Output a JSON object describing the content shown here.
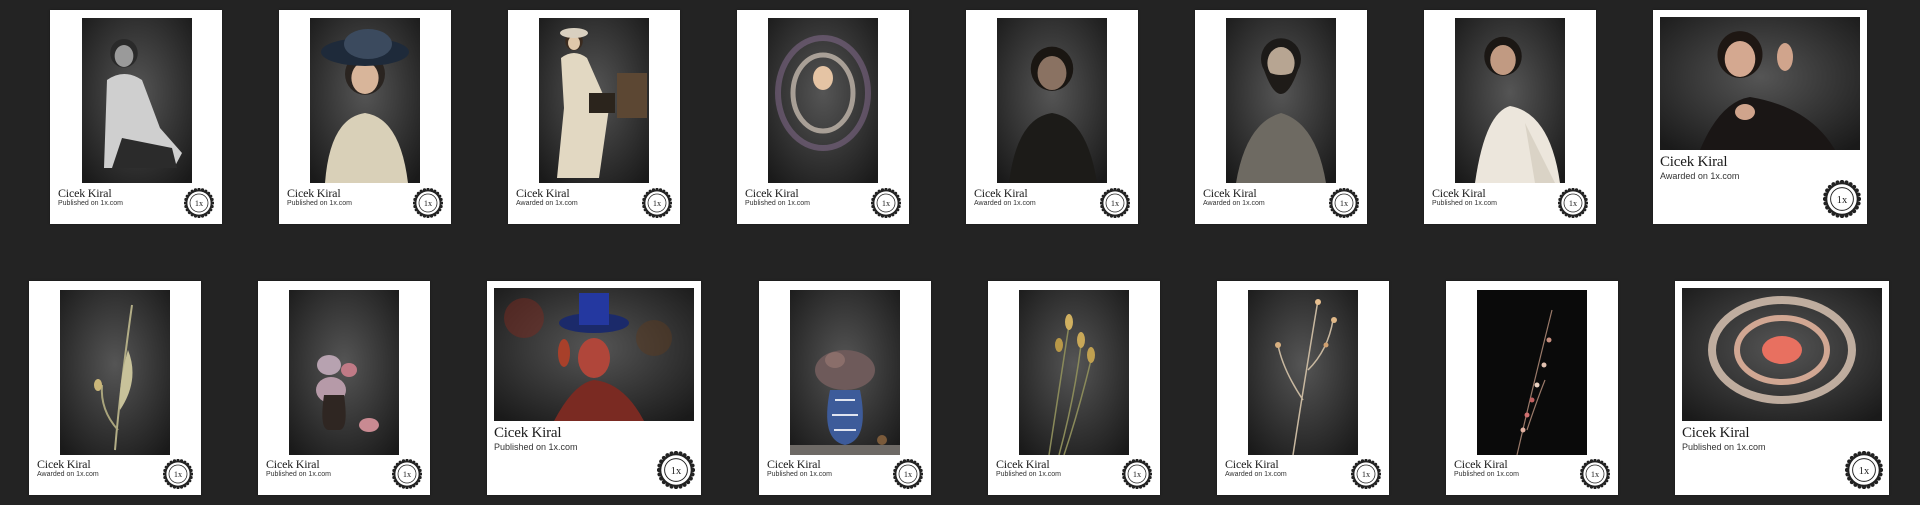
{
  "gallery": {
    "cards": [
      {
        "author": "Cicek Kiral",
        "caption": "Published on 1x.com",
        "badge": "1x-award-badge-icon",
        "subject": "man-portrait"
      },
      {
        "author": "Cicek Kiral",
        "caption": "Published on 1x.com",
        "badge": "1x-award-badge-icon",
        "subject": "woman-with-hat"
      },
      {
        "author": "Cicek Kiral",
        "caption": "Awarded on 1x.com",
        "badge": "1x-award-badge-icon",
        "subject": "seated-woman-vintage"
      },
      {
        "author": "Cicek Kiral",
        "caption": "Published on 1x.com",
        "badge": "1x-award-badge-icon",
        "subject": "spinning-blur-portrait"
      },
      {
        "author": "Cicek Kiral",
        "caption": "Awarded on 1x.com",
        "badge": "1x-award-badge-icon",
        "subject": "dark-woman-portrait"
      },
      {
        "author": "Cicek Kiral",
        "caption": "Awarded on 1x.com",
        "badge": "1x-award-badge-icon",
        "subject": "bearded-man-portrait"
      },
      {
        "author": "Cicek Kiral",
        "caption": "Published on 1x.com",
        "badge": "1x-award-badge-icon",
        "subject": "woman-lace-dress"
      },
      {
        "author": "Cicek Kiral",
        "caption": "Awarded on 1x.com",
        "badge": "1x-award-badge-icon",
        "subject": "woman-curly-hair-pose"
      },
      {
        "author": "Cicek Kiral",
        "caption": "Awarded on 1x.com",
        "badge": "1x-award-badge-icon",
        "subject": "tulip-stem-still-life"
      },
      {
        "author": "Cicek Kiral",
        "caption": "Published on 1x.com",
        "badge": "1x-award-badge-icon",
        "subject": "roses-in-vase"
      },
      {
        "author": "Cicek Kiral",
        "caption": "Published on 1x.com",
        "badge": "1x-award-badge-icon",
        "subject": "glowing-hat-woman"
      },
      {
        "author": "Cicek Kiral",
        "caption": "Published on 1x.com",
        "badge": "1x-award-badge-icon",
        "subject": "blue-vase-dried-flowers"
      },
      {
        "author": "Cicek Kiral",
        "caption": "Published on 1x.com",
        "badge": "1x-award-badge-icon",
        "subject": "dried-seed-pods"
      },
      {
        "author": "Cicek Kiral",
        "caption": "Awarded on 1x.com",
        "badge": "1x-award-badge-icon",
        "subject": "dry-branch-dark"
      },
      {
        "author": "Cicek Kiral",
        "caption": "Published on 1x.com",
        "badge": "1x-award-badge-icon",
        "subject": "berries-branch-black"
      },
      {
        "author": "Cicek Kiral",
        "caption": "Published on 1x.com",
        "badge": "1x-award-badge-icon",
        "subject": "peach-rose-closeup"
      }
    ]
  }
}
